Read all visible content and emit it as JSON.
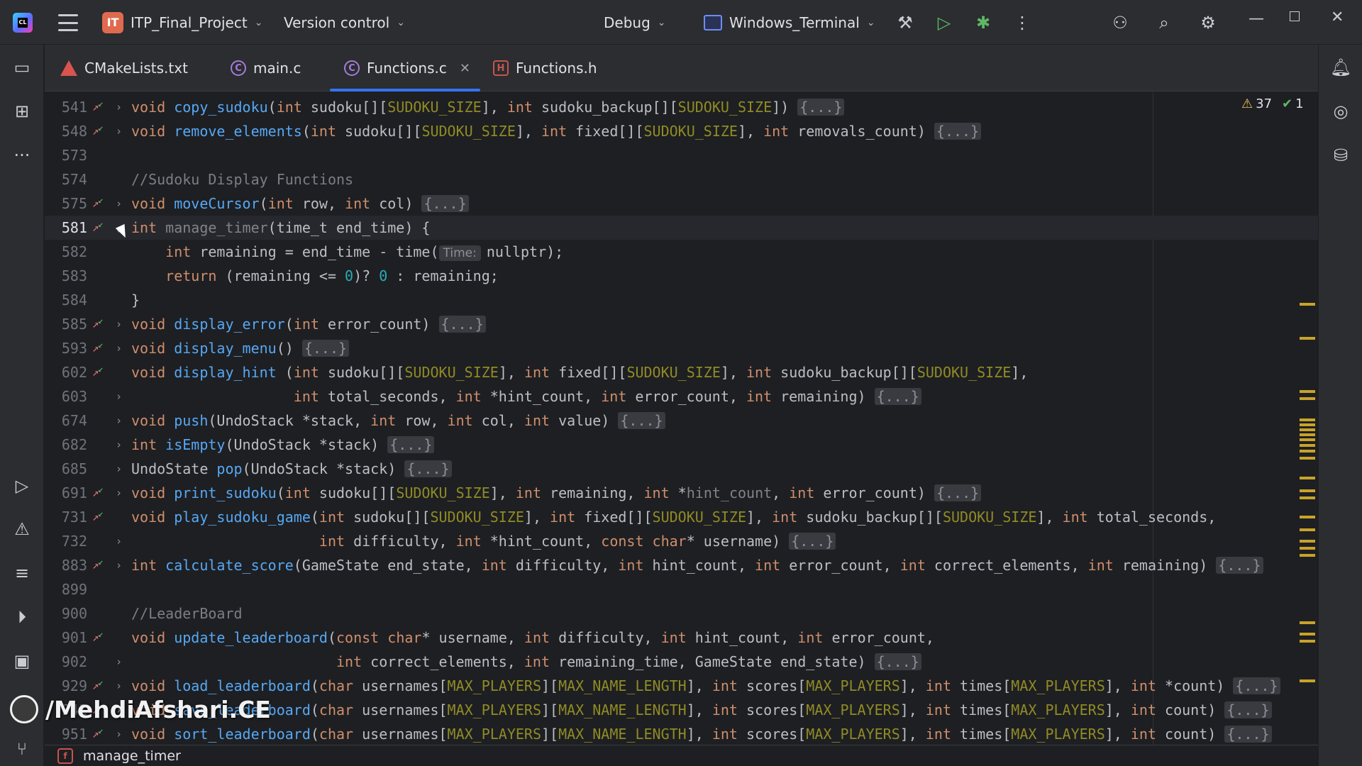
{
  "titlebar": {
    "project_badge": "IT",
    "project_name": "ITP_Final_Project",
    "vcs": "Version control",
    "run_config": "Debug",
    "run_target": "Windows_Terminal"
  },
  "tabs": [
    {
      "label": "CMakeLists.txt",
      "icon": "cmake-file-icon"
    },
    {
      "label": "main.c",
      "icon": "c-file-icon"
    },
    {
      "label": "Functions.c",
      "icon": "c-file-icon",
      "active": true
    },
    {
      "label": "Functions.h",
      "icon": "header-file-icon"
    }
  ],
  "inspections": {
    "warnings": "37",
    "ok": "1"
  },
  "hint": "Time:",
  "lines": [
    {
      "n": "541",
      "gut": true,
      "fold": ">"
    },
    {
      "n": "548",
      "gut": true,
      "fold": ">"
    },
    {
      "n": "573"
    },
    {
      "n": "574",
      "c": "//Sudoku Display Functions"
    },
    {
      "n": "575",
      "gut": true,
      "fold": ">"
    },
    {
      "n": "581",
      "gut": true,
      "fold": "v",
      "current": true
    },
    {
      "n": "582"
    },
    {
      "n": "583"
    },
    {
      "n": "584"
    },
    {
      "n": "585",
      "gut": true,
      "fold": ">"
    },
    {
      "n": "593",
      "gut": true,
      "fold": ">"
    },
    {
      "n": "602",
      "gut": true
    },
    {
      "n": "603",
      "fold": ">"
    },
    {
      "n": "674",
      "fold": ">"
    },
    {
      "n": "682",
      "fold": ">"
    },
    {
      "n": "685",
      "fold": ">"
    },
    {
      "n": "691",
      "gut": true,
      "fold": ">"
    },
    {
      "n": "731",
      "gut": true
    },
    {
      "n": "732",
      "fold": ">"
    },
    {
      "n": "883",
      "gut": true,
      "fold": ">"
    },
    {
      "n": "899"
    },
    {
      "n": "900",
      "c": "//LeaderBoard"
    },
    {
      "n": "901",
      "gut": true
    },
    {
      "n": "902",
      "fold": ">"
    },
    {
      "n": "929",
      "gut": true,
      "fold": ">"
    },
    {
      "n": "941",
      "gut": true,
      "fold": ">"
    },
    {
      "n": "951",
      "gut": true,
      "fold": ">"
    }
  ],
  "code": {
    "kw_void": "void",
    "kw_int": "int",
    "kw_return": "return",
    "kw_char": "char",
    "kw_const": "const",
    "macro_size": "SUDOKU_SIZE",
    "macro_players": "MAX_PLAYERS",
    "macro_name_len": "MAX_NAME_LENGTH",
    "placeholder": "{...}",
    "fn_copy": "copy_sudoku",
    "fn_remove": "remove_elements",
    "fn_move": "moveCursor",
    "fn_timer": "manage_timer",
    "fn_err": "display_error",
    "fn_menu": "display_menu",
    "fn_hint": "display_hint",
    "fn_push": "push",
    "fn_empty": "isEmpty",
    "fn_pop": "pop",
    "fn_print": "print_sudoku",
    "fn_play": "play_sudoku_game",
    "fn_score": "calculate_score",
    "fn_update": "update_leaderboard",
    "fn_load": "load_leaderboard",
    "fn_save": "save_leaderboard",
    "fn_sort": "sort_leaderboard",
    "p_sudoku": "sudoku[][",
    "p_backup": "sudoku_backup[][",
    "p_fixed": "fixed[][",
    "p_removals": "removals_count",
    "p_row": "row",
    "p_col": "col",
    "p_value": "value",
    "p_time_t": "time_t",
    "p_end_time": "end_time",
    "p_remaining": "remaining",
    "p_time_call": "time(",
    "p_nullptr": "nullptr",
    "p_zero": "0",
    "p_error_count": "error_count",
    "p_total_seconds": "total_seconds",
    "p_hint_count": "hint_count",
    "p_undostack": "UndoStack",
    "p_undostate": "UndoState",
    "p_stack": "stack",
    "p_difficulty": "difficulty",
    "p_username": "username",
    "p_gamestate": "GameState",
    "p_end_state": "end_state",
    "p_correct": "correct_elements",
    "p_remaining_time": "remaining_time",
    "p_usernames": "usernames[",
    "p_scores": "scores[",
    "p_times": "times[",
    "p_count": "count"
  },
  "status": {
    "breadcrumb": "manage_timer"
  },
  "watermark": "/MehdiAfshari.CE"
}
